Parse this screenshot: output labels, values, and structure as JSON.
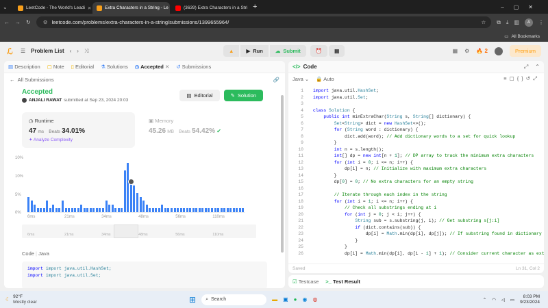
{
  "browser": {
    "tabs": [
      {
        "title": "LeetCode - The World's Leadi",
        "color": "#f89f1b",
        "active": false
      },
      {
        "title": "Extra Characters in a String - Le",
        "color": "#f89f1b",
        "active": true
      },
      {
        "title": "(3639) Extra Characters in a Stri",
        "color": "#ff0000",
        "active": false
      }
    ],
    "url": "leetcode.com/problems/extra-characters-in-a-string/submissions/1399655964/",
    "bookmarks_label": "All Bookmarks"
  },
  "nav": {
    "problem_list": "Problem List",
    "run": "Run",
    "submit": "Submit",
    "streak": "2",
    "premium": "Premium"
  },
  "left_tabs": [
    "Description",
    "Note",
    "Editorial",
    "Solutions",
    "Accepted",
    "Submissions"
  ],
  "submission": {
    "back": "All Submissions",
    "status": "Accepted",
    "user": "ANJALI RAWAT",
    "submitted": "submitted at Sep 23, 2024 20:03",
    "editorial_btn": "Editorial",
    "solution_btn": "Solution",
    "runtime_label": "Runtime",
    "runtime_value": "47",
    "runtime_unit": "ms",
    "beats_label": "Beats",
    "runtime_beats": "34.01%",
    "analyze": "Analyze Complexity",
    "memory_label": "Memory",
    "memory_value": "45.26",
    "memory_unit": "MB",
    "memory_beats": "54.42%"
  },
  "chart_data": {
    "type": "bar",
    "y_ticks": [
      "10%",
      "10%",
      "5%",
      "0%"
    ],
    "x_ticks": [
      "6ms",
      "21ms",
      "34ms",
      "48ms",
      "56ms",
      "110ms"
    ],
    "values": [
      4,
      3,
      2,
      1,
      1,
      1,
      3,
      1,
      2,
      1,
      1,
      3,
      1,
      1,
      1,
      1,
      1,
      2,
      1,
      1,
      1,
      1,
      1,
      1,
      1,
      3,
      2,
      2,
      1,
      1,
      1,
      11,
      13,
      8,
      7,
      5,
      4,
      3,
      2,
      1,
      1,
      1,
      1,
      2,
      1,
      1,
      1,
      1,
      1,
      1,
      1,
      1,
      1,
      1,
      1,
      1,
      1,
      1,
      1,
      1,
      1,
      1,
      1,
      1,
      1,
      1,
      1,
      1,
      1,
      1
    ],
    "highlight_index": 33,
    "ylim": [
      0,
      15
    ]
  },
  "code_section": {
    "label": "Code",
    "lang": "Java"
  },
  "editor": {
    "title": "Code",
    "lang": "Java",
    "mode": "Auto",
    "status_left": "Saved",
    "status_right": "Ln 31, Col 2",
    "lines": [
      "import java.util.HashSet;",
      "import java.util.Set;",
      "",
      "class Solution {",
      "    public int minExtraChar(String s, String[] dictionary) {",
      "        Set<String> dict = new HashSet<>();",
      "        for (String word : dictionary) {",
      "            dict.add(word); // Add dictionary words to a set for quick lookup",
      "        }",
      "        int n = s.length();",
      "        int[] dp = new int[n + 1]; // DP array to track the minimum extra characters",
      "        for (int i = 0; i <= n; i++) {",
      "            dp[i] = n; // Initialize with maximum extra characters",
      "        }",
      "        dp[0] = 0; // No extra characters for an empty string",
      "",
      "        // Iterate through each index in the string",
      "        for (int i = 1; i <= n; i++) {",
      "            // Check all substrings ending at i",
      "            for (int j = 0; j < i; j++) {",
      "                String sub = s.substring(j, i); // Get substring s[j:i]",
      "                if (dict.contains(sub)) {",
      "                    dp[i] = Math.min(dp[i], dp[j]); // If substring found in dictionary",
      "                }",
      "            }",
      "            dp[i] = Math.min(dp[i], dp[i - 1] + 1); // Consider current character as extra"
    ]
  },
  "preview_code": [
    "import java.util.HashSet;",
    "import java.util.Set;",
    "",
    "class Solution {"
  ],
  "bottom": {
    "testcase": "Testcase",
    "result": "Test Result"
  },
  "taskbar": {
    "temp": "92°F",
    "weather": "Mostly clear",
    "search": "Search",
    "time": "8:03 PM",
    "date": "9/23/2024"
  }
}
